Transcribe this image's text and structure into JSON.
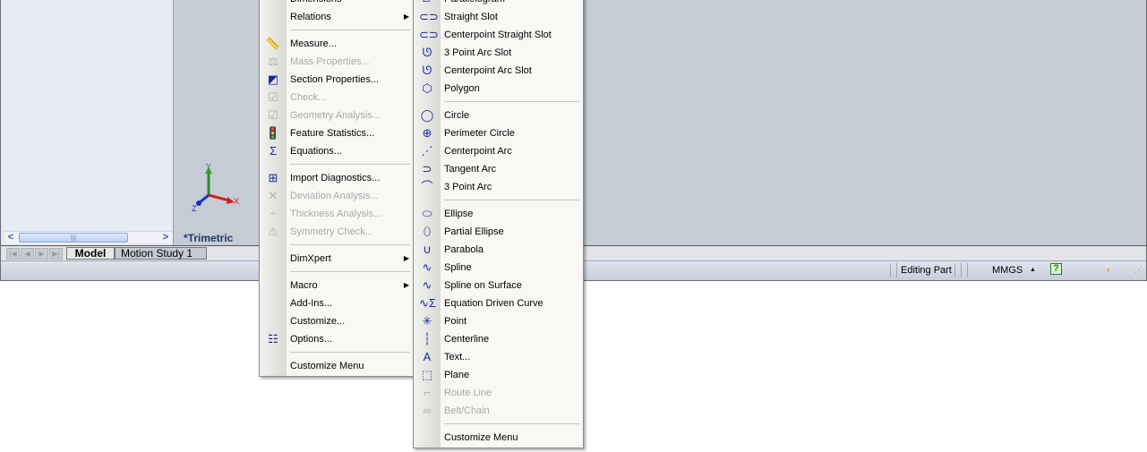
{
  "viewport": {
    "view_label": "*Trimetric",
    "axes": {
      "x": "X",
      "y": "Y",
      "z": "Z"
    }
  },
  "bottom_tabs": [
    {
      "label": "Model",
      "active": true
    },
    {
      "label": "Motion Study 1",
      "active": false
    }
  ],
  "statusbar": {
    "mode": "Editing Part",
    "units": "MMGS",
    "units_arrow": "▲",
    "help_icon": "?"
  },
  "scrollbar": {
    "left": "<",
    "right": ">",
    "grip": "|||"
  },
  "tools_menu": {
    "items": [
      {
        "label": "Dimensions",
        "icon": "dimensions-icon",
        "glyph": "",
        "enabled": true
      },
      {
        "label": "Relations",
        "icon": "relations-icon",
        "glyph": "",
        "enabled": true,
        "submenu": true
      },
      {
        "sep": true
      },
      {
        "label": "Measure...",
        "icon": "measure-icon",
        "glyph": "📏",
        "enabled": true
      },
      {
        "label": "Mass Properties...",
        "icon": "mass-properties-icon",
        "glyph": "⚖",
        "enabled": false
      },
      {
        "label": "Section Properties...",
        "icon": "section-properties-icon",
        "glyph": "◩",
        "enabled": true
      },
      {
        "label": "Check...",
        "icon": "check-icon",
        "glyph": "☑",
        "enabled": false
      },
      {
        "label": "Geometry Analysis...",
        "icon": "geometry-analysis-icon",
        "glyph": "☑",
        "enabled": false
      },
      {
        "label": "Feature Statistics...",
        "icon": "feature-statistics-icon",
        "glyph": "🚦",
        "enabled": true
      },
      {
        "label": "Equations...",
        "icon": "equations-icon",
        "glyph": "Σ",
        "enabled": true
      },
      {
        "sep": true
      },
      {
        "label": "Import Diagnostics...",
        "icon": "import-diagnostics-icon",
        "glyph": "⊞",
        "enabled": true
      },
      {
        "label": "Deviation  Analysis...",
        "icon": "deviation-analysis-icon",
        "glyph": "✕",
        "enabled": false
      },
      {
        "label": "Thickness Analysis...",
        "icon": "thickness-analysis-icon",
        "glyph": "÷",
        "enabled": false
      },
      {
        "label": "Symmetry Check...",
        "icon": "symmetry-check-icon",
        "glyph": "⚠",
        "enabled": false
      },
      {
        "sep": true
      },
      {
        "label": "DimXpert",
        "icon": "dimxpert-icon",
        "glyph": "",
        "enabled": true,
        "submenu": true
      },
      {
        "sep": true
      },
      {
        "label": "Macro",
        "icon": "macro-icon",
        "glyph": "",
        "enabled": true,
        "submenu": true
      },
      {
        "label": "Add-Ins...",
        "icon": "add-ins-icon",
        "glyph": "",
        "enabled": true
      },
      {
        "label": "Customize...",
        "icon": "customize-icon",
        "glyph": "",
        "enabled": true
      },
      {
        "label": "Options...",
        "icon": "options-icon",
        "glyph": "☷",
        "enabled": true
      },
      {
        "sep": true
      },
      {
        "label": "Customize Menu",
        "icon": "customize-menu-icon",
        "glyph": "",
        "enabled": true
      }
    ]
  },
  "sketch_entities_menu": {
    "items": [
      {
        "label": "Parallelogram",
        "icon": "parallelogram-icon",
        "glyph": "▱",
        "enabled": true
      },
      {
        "label": "Straight Slot",
        "icon": "straight-slot-icon",
        "glyph": "⊂⊃",
        "enabled": true
      },
      {
        "label": "Centerpoint Straight Slot",
        "icon": "centerpoint-straight-slot-icon",
        "glyph": "⊂⊃",
        "enabled": true
      },
      {
        "label": "3 Point Arc Slot",
        "icon": "3-point-arc-slot-icon",
        "glyph": "ᘎ",
        "enabled": true
      },
      {
        "label": "Centerpoint Arc Slot",
        "icon": "centerpoint-arc-slot-icon",
        "glyph": "ᘎ",
        "enabled": true
      },
      {
        "label": "Polygon",
        "icon": "polygon-icon",
        "glyph": "⬡",
        "enabled": true
      },
      {
        "sep": true
      },
      {
        "label": "Circle",
        "icon": "circle-icon",
        "glyph": "◯",
        "enabled": true
      },
      {
        "label": "Perimeter Circle",
        "icon": "perimeter-circle-icon",
        "glyph": "⊕",
        "enabled": true
      },
      {
        "label": "Centerpoint Arc",
        "icon": "centerpoint-arc-icon",
        "glyph": "⋰",
        "enabled": true
      },
      {
        "label": "Tangent Arc",
        "icon": "tangent-arc-icon",
        "glyph": "⊃",
        "enabled": true
      },
      {
        "label": "3 Point Arc",
        "icon": "3-point-arc-icon",
        "glyph": "⌒",
        "enabled": true
      },
      {
        "sep": true
      },
      {
        "label": "Ellipse",
        "icon": "ellipse-icon",
        "glyph": "⬭",
        "enabled": true
      },
      {
        "label": "Partial Ellipse",
        "icon": "partial-ellipse-icon",
        "glyph": "⬯",
        "enabled": true
      },
      {
        "label": "Parabola",
        "icon": "parabola-icon",
        "glyph": "∪",
        "enabled": true
      },
      {
        "label": "Spline",
        "icon": "spline-icon",
        "glyph": "∿",
        "enabled": true
      },
      {
        "label": "Spline on Surface",
        "icon": "spline-on-surface-icon",
        "glyph": "∿",
        "enabled": true
      },
      {
        "label": "Equation Driven Curve",
        "icon": "equation-driven-curve-icon",
        "glyph": "∿Σ",
        "enabled": true
      },
      {
        "label": "Point",
        "icon": "point-icon",
        "glyph": "✳",
        "enabled": true
      },
      {
        "label": "Centerline",
        "icon": "centerline-icon",
        "glyph": "┆",
        "enabled": true
      },
      {
        "label": "Text...",
        "icon": "text-icon",
        "glyph": "A",
        "enabled": true
      },
      {
        "label": "Plane",
        "icon": "plane-icon",
        "glyph": "⬚",
        "enabled": true
      },
      {
        "label": "Route Line",
        "icon": "route-line-icon",
        "glyph": "⌐",
        "enabled": false
      },
      {
        "label": "Belt/Chain",
        "icon": "belt-chain-icon",
        "glyph": "∞",
        "enabled": false
      },
      {
        "sep": true
      },
      {
        "label": "Customize Menu",
        "icon": "customize-menu-icon",
        "glyph": "",
        "enabled": true
      }
    ]
  }
}
